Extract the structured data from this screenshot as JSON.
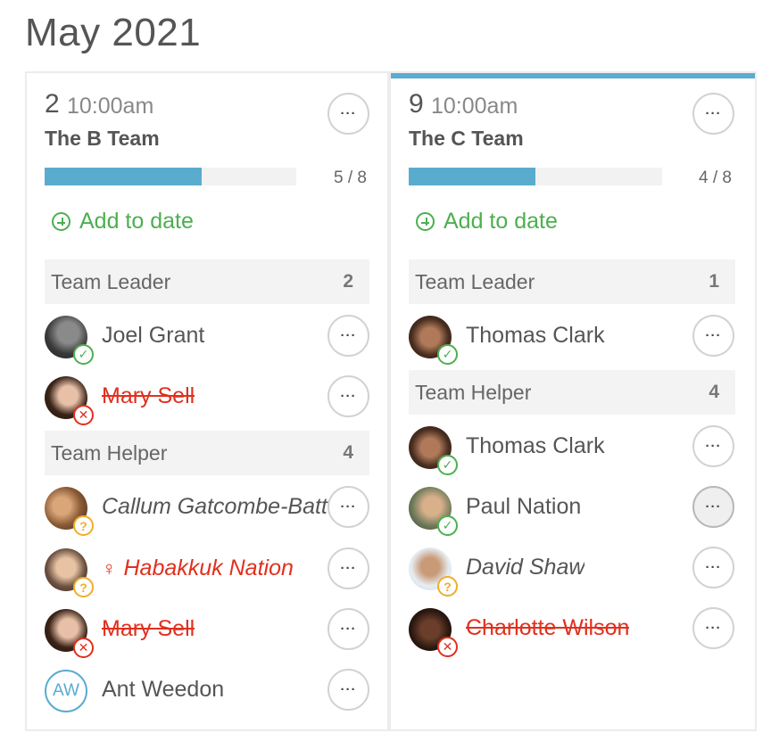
{
  "title": "May 2021",
  "columns": [
    {
      "date": "2",
      "time": "10:00am",
      "team": "The B Team",
      "progress": {
        "filled": 5,
        "total": 8,
        "label": "5 / 8",
        "fraction": 0.625
      },
      "add_label": "Add to date",
      "roles": [
        {
          "name": "Team Leader",
          "count": "2"
        },
        {
          "name": "Team Helper",
          "count": "4"
        }
      ],
      "people": [
        {
          "name": "Joel Grant",
          "status": "accepted"
        },
        {
          "name": "Mary Sell",
          "status": "declined"
        },
        {
          "name": "Callum Gatcombe-Batt",
          "status": "pending"
        },
        {
          "name": "Habakkuk Nation",
          "status": "pending"
        },
        {
          "name": "Mary Sell",
          "status": "declined"
        },
        {
          "name": "Ant Weedon",
          "initials": "AW",
          "status": "none"
        }
      ]
    },
    {
      "date": "9",
      "time": "10:00am",
      "team": "The C Team",
      "progress": {
        "filled": 4,
        "total": 8,
        "label": "4 / 8",
        "fraction": 0.5
      },
      "add_label": "Add to date",
      "roles": [
        {
          "name": "Team Leader",
          "count": "1"
        },
        {
          "name": "Team Helper",
          "count": "4"
        }
      ],
      "people": [
        {
          "name": "Thomas Clark",
          "status": "accepted"
        },
        {
          "name": "Thomas Clark",
          "status": "accepted"
        },
        {
          "name": "Paul Nation",
          "status": "accepted"
        },
        {
          "name": "David Shaw",
          "status": "pending"
        },
        {
          "name": "Charlotte Wilson",
          "status": "declined"
        }
      ]
    }
  ],
  "more_label": "···",
  "icons": {
    "accepted": "check-circle-icon",
    "declined": "x-circle-icon",
    "pending": "question-circle-icon",
    "add": "plus-circle-icon",
    "alert": "person-alert-icon"
  },
  "colors": {
    "accent": "#5aaccf",
    "success": "#4caf50",
    "danger": "#e0301e",
    "warning": "#f0ad2a"
  }
}
